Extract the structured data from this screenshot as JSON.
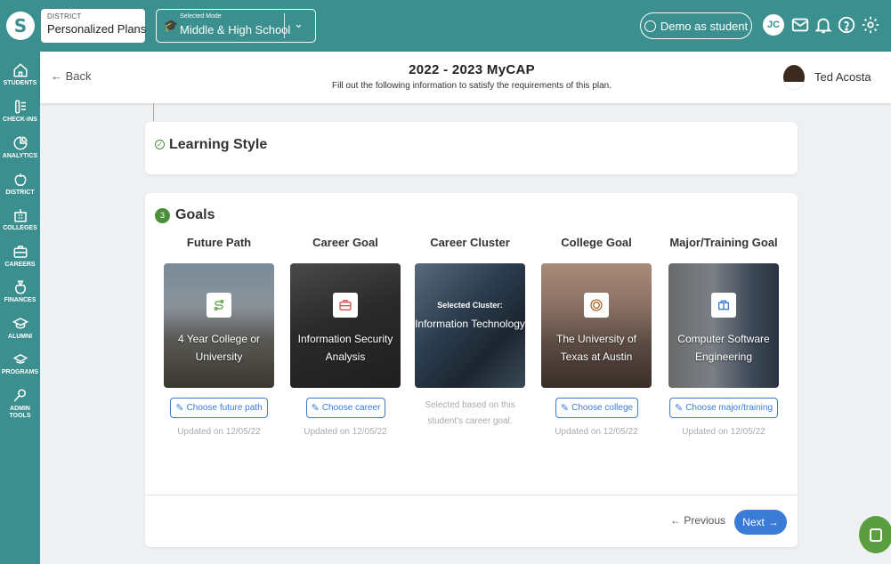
{
  "brand": {
    "logo_letter": "S"
  },
  "district": {
    "label": "DISTRICT",
    "name": "Personalized Plans"
  },
  "mode": {
    "label": "Selected Mode",
    "value": "Middle & High School"
  },
  "topbar": {
    "demo_label": "Demo as student",
    "user_initials": "JC"
  },
  "sidebar": {
    "items": [
      {
        "label": "STUDENTS",
        "icon": "home-icon"
      },
      {
        "label": "CHECK-INS",
        "icon": "checklist-icon"
      },
      {
        "label": "ANALYTICS",
        "icon": "pie-chart-icon"
      },
      {
        "label": "DISTRICT",
        "icon": "apple-icon"
      },
      {
        "label": "COLLEGES",
        "icon": "school-icon"
      },
      {
        "label": "CAREERS",
        "icon": "briefcase-icon"
      },
      {
        "label": "FINANCES",
        "icon": "money-bag-icon"
      },
      {
        "label": "ALUMNI",
        "icon": "graduation-cap-icon"
      },
      {
        "label": "PROGRAMS",
        "icon": "programs-icon"
      },
      {
        "label": "ADMIN",
        "label2": "TOOLS",
        "icon": "wrench-icon"
      }
    ]
  },
  "header": {
    "back_label": "Back",
    "title": "2022 - 2023 MyCAP",
    "subtitle": "Fill out the following information to satisfy the requirements of this plan.",
    "user_name": "Ted Acosta"
  },
  "learning_style": {
    "title": "Learning Style",
    "check": "✓"
  },
  "goals": {
    "number": "3",
    "title": "Goals",
    "columns": [
      {
        "title": "Future Path",
        "tile_text": "4 Year College or University",
        "button": "Choose future path",
        "updated": "Updated on 12/05/22",
        "icon": "path-icon"
      },
      {
        "title": "Career Goal",
        "tile_text": "Information Security Analysis",
        "button": "Choose career",
        "updated": "Updated on 12/05/22",
        "icon": "briefcase-icon"
      },
      {
        "title": "Career Cluster",
        "selected_label": "Selected Cluster:",
        "tile_text": "Information Technology",
        "note": "Selected based on this student's career goal."
      },
      {
        "title": "College Goal",
        "tile_text": "The University of Texas at Austin",
        "button": "Choose college",
        "updated": "Updated on 12/05/22",
        "icon": "university-seal-icon"
      },
      {
        "title": "Major/Training Goal",
        "tile_text": "Computer Software Engineering",
        "button": "Choose major/training",
        "updated": "Updated on 12/05/22",
        "icon": "books-icon"
      }
    ],
    "previous_label": "Previous",
    "next_label": "Next"
  },
  "colors": {
    "teal": "#3b8f8f",
    "blue": "#3a7bd5",
    "green": "#4c8f3a"
  }
}
